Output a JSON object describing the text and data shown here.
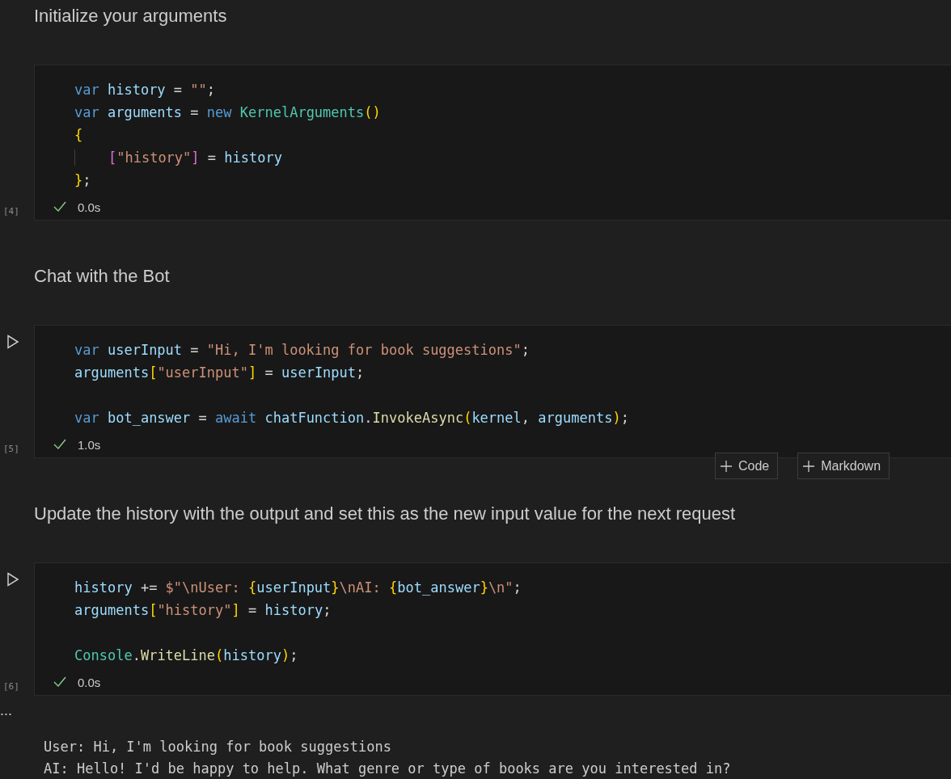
{
  "cells": [
    {
      "kind": "markdown",
      "text": "Initialize your arguments"
    },
    {
      "kind": "code",
      "run_button": false,
      "execution_count": "[4]",
      "succeeded": true,
      "duration": "0.0s",
      "blocks": [
        [
          {
            "indent": false,
            "tokens": [
              {
                "kind": "kw",
                "text": "var "
              },
              {
                "kind": "id",
                "text": "history"
              },
              {
                "kind": "plain",
                "text": " = "
              },
              {
                "kind": "str",
                "text": "\"\""
              },
              {
                "kind": "plain",
                "text": ";"
              }
            ]
          },
          {
            "indent": false,
            "tokens": [
              {
                "kind": "kw",
                "text": "var "
              },
              {
                "kind": "id",
                "text": "arguments"
              },
              {
                "kind": "plain",
                "text": " = "
              },
              {
                "kind": "kw",
                "text": "new "
              },
              {
                "kind": "type",
                "text": "KernelArguments"
              },
              {
                "kind": "br1",
                "text": "()"
              }
            ]
          },
          {
            "indent": false,
            "tokens": [
              {
                "kind": "br1",
                "text": "{"
              }
            ]
          },
          {
            "indent": true,
            "tokens": [
              {
                "kind": "br2",
                "text": "["
              },
              {
                "kind": "str",
                "text": "\"history\""
              },
              {
                "kind": "br2",
                "text": "]"
              },
              {
                "kind": "plain",
                "text": " = "
              },
              {
                "kind": "id",
                "text": "history"
              }
            ]
          },
          {
            "indent": false,
            "tokens": [
              {
                "kind": "br1",
                "text": "}"
              },
              {
                "kind": "plain",
                "text": ";"
              }
            ]
          }
        ]
      ]
    },
    {
      "kind": "markdown",
      "text": "Chat with the Bot"
    },
    {
      "kind": "code",
      "run_button": true,
      "execution_count": "[5]",
      "succeeded": true,
      "duration": "1.0s",
      "blocks": [
        [
          {
            "indent": false,
            "tokens": [
              {
                "kind": "kw",
                "text": "var "
              },
              {
                "kind": "id",
                "text": "userInput"
              },
              {
                "kind": "plain",
                "text": " = "
              },
              {
                "kind": "str",
                "text": "\"Hi, I'm looking for book suggestions\""
              },
              {
                "kind": "plain",
                "text": ";"
              }
            ]
          },
          {
            "indent": false,
            "tokens": [
              {
                "kind": "id",
                "text": "arguments"
              },
              {
                "kind": "br1",
                "text": "["
              },
              {
                "kind": "str",
                "text": "\"userInput\""
              },
              {
                "kind": "br1",
                "text": "]"
              },
              {
                "kind": "plain",
                "text": " = "
              },
              {
                "kind": "id",
                "text": "userInput"
              },
              {
                "kind": "plain",
                "text": ";"
              }
            ]
          }
        ],
        [
          {
            "indent": false,
            "tokens": [
              {
                "kind": "kw",
                "text": "var "
              },
              {
                "kind": "id",
                "text": "bot_answer"
              },
              {
                "kind": "plain",
                "text": " = "
              },
              {
                "kind": "kw",
                "text": "await "
              },
              {
                "kind": "id",
                "text": "chatFunction"
              },
              {
                "kind": "plain",
                "text": "."
              },
              {
                "kind": "fn",
                "text": "InvokeAsync"
              },
              {
                "kind": "br1",
                "text": "("
              },
              {
                "kind": "id",
                "text": "kernel"
              },
              {
                "kind": "plain",
                "text": ", "
              },
              {
                "kind": "id",
                "text": "arguments"
              },
              {
                "kind": "br1",
                "text": ")"
              },
              {
                "kind": "plain",
                "text": ";"
              }
            ]
          }
        ]
      ],
      "toolbar": [
        {
          "label": "Code"
        },
        {
          "label": "Markdown"
        }
      ]
    },
    {
      "kind": "markdown",
      "text": "Update the history with the output and set this as the new input value for the next request"
    },
    {
      "kind": "code",
      "run_button": true,
      "execution_count": "[6]",
      "succeeded": true,
      "duration": "0.0s",
      "blocks": [
        [
          {
            "indent": false,
            "tokens": [
              {
                "kind": "id",
                "text": "history"
              },
              {
                "kind": "plain",
                "text": " += "
              },
              {
                "kind": "str",
                "text": "$\"\\nUser: "
              },
              {
                "kind": "br1",
                "text": "{"
              },
              {
                "kind": "id",
                "text": "userInput"
              },
              {
                "kind": "br1",
                "text": "}"
              },
              {
                "kind": "str",
                "text": "\\nAI: "
              },
              {
                "kind": "br1",
                "text": "{"
              },
              {
                "kind": "id",
                "text": "bot_answer"
              },
              {
                "kind": "br1",
                "text": "}"
              },
              {
                "kind": "str",
                "text": "\\n\""
              },
              {
                "kind": "plain",
                "text": ";"
              }
            ]
          },
          {
            "indent": false,
            "tokens": [
              {
                "kind": "id",
                "text": "arguments"
              },
              {
                "kind": "br1",
                "text": "["
              },
              {
                "kind": "str",
                "text": "\"history\""
              },
              {
                "kind": "br1",
                "text": "]"
              },
              {
                "kind": "plain",
                "text": " = "
              },
              {
                "kind": "id",
                "text": "history"
              },
              {
                "kind": "plain",
                "text": ";"
              }
            ]
          }
        ],
        [
          {
            "indent": false,
            "tokens": [
              {
                "kind": "type",
                "text": "Console"
              },
              {
                "kind": "plain",
                "text": "."
              },
              {
                "kind": "fn",
                "text": "WriteLine"
              },
              {
                "kind": "br1",
                "text": "("
              },
              {
                "kind": "id",
                "text": "history"
              },
              {
                "kind": "br1",
                "text": ")"
              },
              {
                "kind": "plain",
                "text": ";"
              }
            ]
          }
        ]
      ],
      "output": {
        "menu": "...",
        "lines": [
          "User: Hi, I'm looking for book suggestions",
          "AI: Hello! I'd be happy to help. What genre or type of books are you interested in?"
        ]
      }
    }
  ]
}
